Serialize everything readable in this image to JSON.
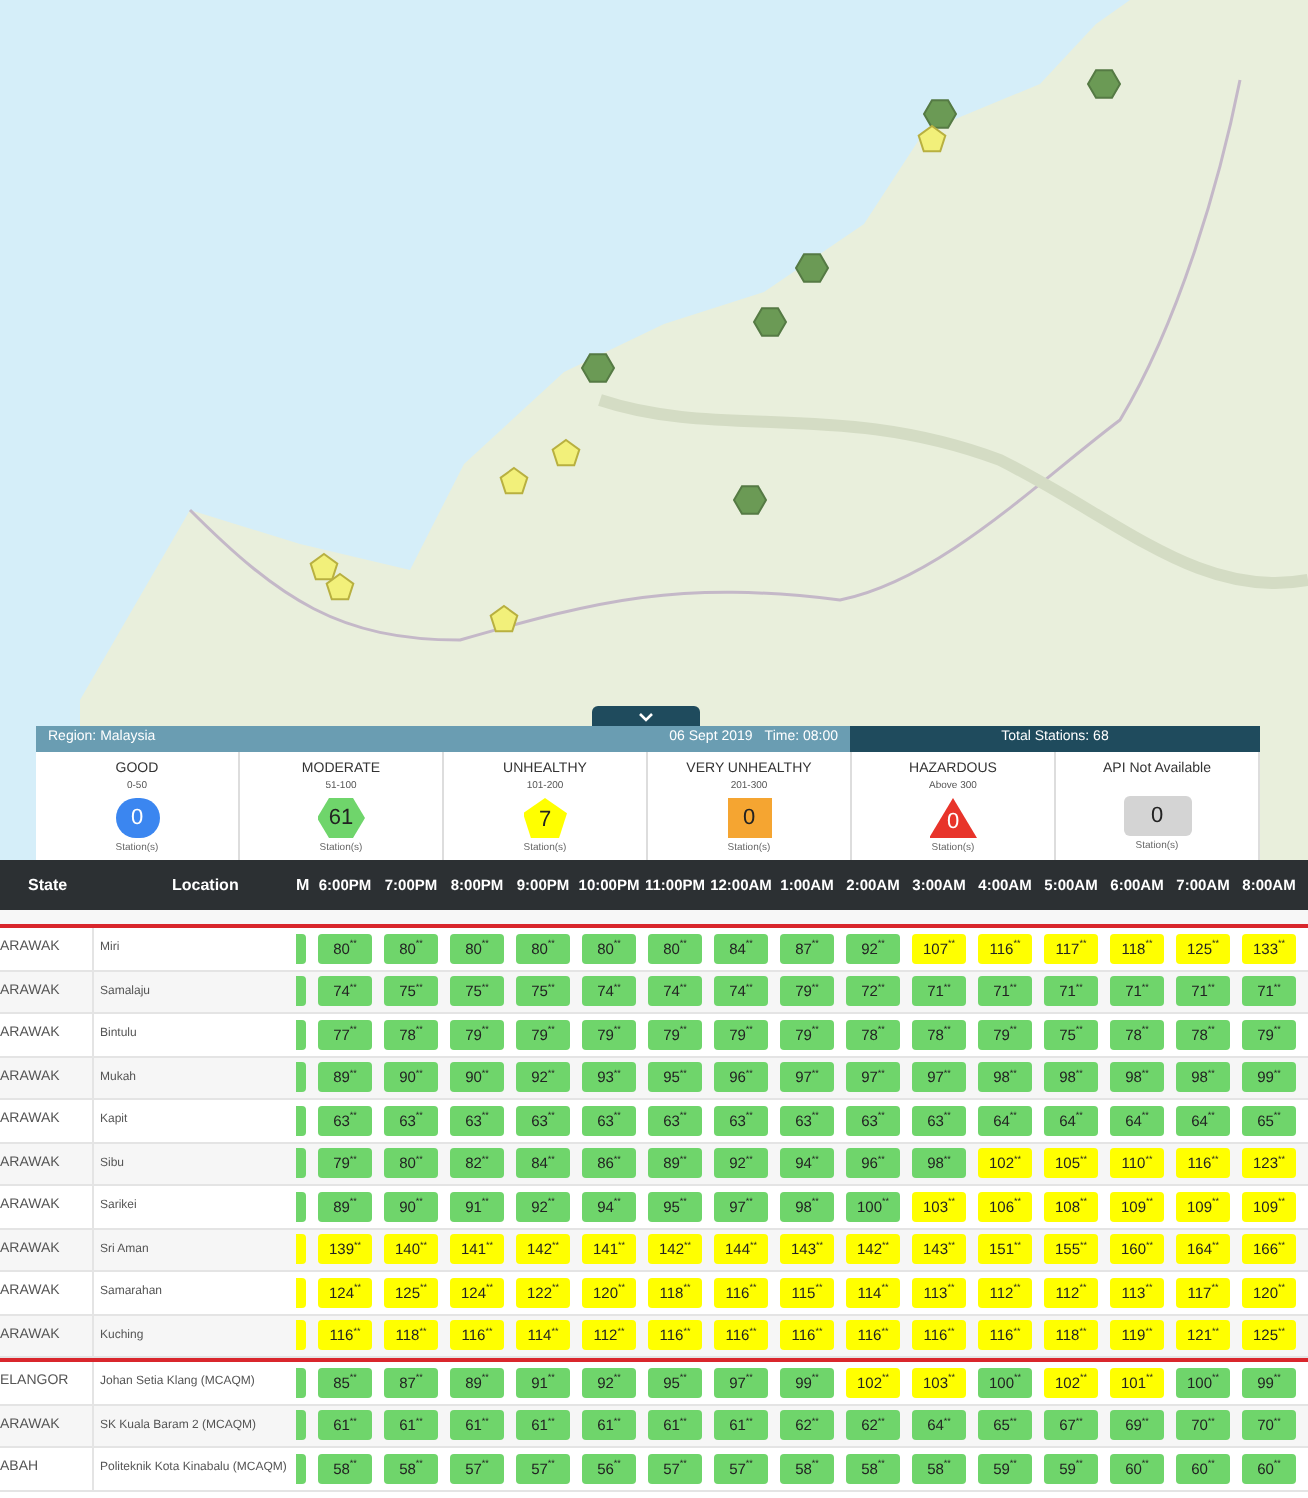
{
  "panel": {
    "region": "Region: Malaysia",
    "date": "06 Sept 2019",
    "time": "Time: 08:00",
    "total": "Total Stations: 68"
  },
  "categories": [
    {
      "name": "GOOD",
      "range": "0-50",
      "count": "0",
      "kind": "circle",
      "color": "#3b86f0",
      "caption": "Station(s)"
    },
    {
      "name": "MODERATE",
      "range": "51-100",
      "count": "61",
      "kind": "hexagon",
      "color": "#6fd56b",
      "caption": "Station(s)"
    },
    {
      "name": "UNHEALTHY",
      "range": "101-200",
      "count": "7",
      "kind": "pentagon",
      "color": "#ffff00",
      "caption": "Station(s)"
    },
    {
      "name": "VERY UNHEALTHY",
      "range": "201-300",
      "count": "0",
      "kind": "square",
      "color": "#f5a531",
      "caption": "Station(s)"
    },
    {
      "name": "HAZARDOUS",
      "range": "Above 300",
      "count": "0",
      "kind": "triangle",
      "color": "#e8342a",
      "caption": "Station(s)"
    },
    {
      "name": "API Not Available",
      "count": "0",
      "kind": "rounded",
      "color": "#d4d4d4",
      "caption": "Station(s)"
    }
  ],
  "table": {
    "columns": [
      "State",
      "Location",
      "M",
      "6:00PM",
      "7:00PM",
      "8:00PM",
      "9:00PM",
      "10:00PM",
      "11:00PM",
      "12:00AM",
      "1:00AM",
      "2:00AM",
      "3:00AM",
      "4:00AM",
      "5:00AM",
      "6:00AM",
      "7:00AM",
      "8:00AM"
    ],
    "groups": [
      {
        "rows": [
          {
            "state": "ARAWAK",
            "location": "Miri",
            "cut_cell": {
              "color": "#6fd56b"
            },
            "cells": [
              {
                "value": "80",
                "flag": "**",
                "color": "#6fd56b"
              },
              {
                "value": "80",
                "flag": "**",
                "color": "#6fd56b"
              },
              {
                "value": "80",
                "flag": "**",
                "color": "#6fd56b"
              },
              {
                "value": "80",
                "flag": "**",
                "color": "#6fd56b"
              },
              {
                "value": "80",
                "flag": "**",
                "color": "#6fd56b"
              },
              {
                "value": "80",
                "flag": "**",
                "color": "#6fd56b"
              },
              {
                "value": "84",
                "flag": "**",
                "color": "#6fd56b"
              },
              {
                "value": "87",
                "flag": "**",
                "color": "#6fd56b"
              },
              {
                "value": "92",
                "flag": "**",
                "color": "#6fd56b"
              },
              {
                "value": "107",
                "flag": "**",
                "color": "#ffff00"
              },
              {
                "value": "116",
                "flag": "**",
                "color": "#ffff00"
              },
              {
                "value": "117",
                "flag": "**",
                "color": "#ffff00"
              },
              {
                "value": "118",
                "flag": "**",
                "color": "#ffff00"
              },
              {
                "value": "125",
                "flag": "**",
                "color": "#ffff00"
              },
              {
                "value": "133",
                "flag": "**",
                "color": "#ffff00"
              }
            ]
          },
          {
            "state": "ARAWAK",
            "location": "Samalaju",
            "cut_cell": {
              "color": "#6fd56b"
            },
            "cells": [
              {
                "value": "74",
                "flag": "**",
                "color": "#6fd56b"
              },
              {
                "value": "75",
                "flag": "**",
                "color": "#6fd56b"
              },
              {
                "value": "75",
                "flag": "**",
                "color": "#6fd56b"
              },
              {
                "value": "75",
                "flag": "**",
                "color": "#6fd56b"
              },
              {
                "value": "74",
                "flag": "**",
                "color": "#6fd56b"
              },
              {
                "value": "74",
                "flag": "**",
                "color": "#6fd56b"
              },
              {
                "value": "74",
                "flag": "**",
                "color": "#6fd56b"
              },
              {
                "value": "79",
                "flag": "**",
                "color": "#6fd56b"
              },
              {
                "value": "72",
                "flag": "**",
                "color": "#6fd56b"
              },
              {
                "value": "71",
                "flag": "**",
                "color": "#6fd56b"
              },
              {
                "value": "71",
                "flag": "**",
                "color": "#6fd56b"
              },
              {
                "value": "71",
                "flag": "**",
                "color": "#6fd56b"
              },
              {
                "value": "71",
                "flag": "**",
                "color": "#6fd56b"
              },
              {
                "value": "71",
                "flag": "**",
                "color": "#6fd56b"
              },
              {
                "value": "71",
                "flag": "**",
                "color": "#6fd56b"
              }
            ]
          },
          {
            "state": "ARAWAK",
            "location": "Bintulu",
            "cut_cell": {
              "color": "#6fd56b"
            },
            "cells": [
              {
                "value": "77",
                "flag": "**",
                "color": "#6fd56b"
              },
              {
                "value": "78",
                "flag": "**",
                "color": "#6fd56b"
              },
              {
                "value": "79",
                "flag": "**",
                "color": "#6fd56b"
              },
              {
                "value": "79",
                "flag": "**",
                "color": "#6fd56b"
              },
              {
                "value": "79",
                "flag": "**",
                "color": "#6fd56b"
              },
              {
                "value": "79",
                "flag": "**",
                "color": "#6fd56b"
              },
              {
                "value": "79",
                "flag": "**",
                "color": "#6fd56b"
              },
              {
                "value": "79",
                "flag": "**",
                "color": "#6fd56b"
              },
              {
                "value": "78",
                "flag": "**",
                "color": "#6fd56b"
              },
              {
                "value": "78",
                "flag": "**",
                "color": "#6fd56b"
              },
              {
                "value": "79",
                "flag": "**",
                "color": "#6fd56b"
              },
              {
                "value": "75",
                "flag": "**",
                "color": "#6fd56b"
              },
              {
                "value": "78",
                "flag": "**",
                "color": "#6fd56b"
              },
              {
                "value": "78",
                "flag": "**",
                "color": "#6fd56b"
              },
              {
                "value": "79",
                "flag": "**",
                "color": "#6fd56b"
              }
            ]
          },
          {
            "state": "ARAWAK",
            "location": "Mukah",
            "cut_cell": {
              "color": "#6fd56b"
            },
            "cells": [
              {
                "value": "89",
                "flag": "**",
                "color": "#6fd56b"
              },
              {
                "value": "90",
                "flag": "**",
                "color": "#6fd56b"
              },
              {
                "value": "90",
                "flag": "**",
                "color": "#6fd56b"
              },
              {
                "value": "92",
                "flag": "**",
                "color": "#6fd56b"
              },
              {
                "value": "93",
                "flag": "**",
                "color": "#6fd56b"
              },
              {
                "value": "95",
                "flag": "**",
                "color": "#6fd56b"
              },
              {
                "value": "96",
                "flag": "**",
                "color": "#6fd56b"
              },
              {
                "value": "97",
                "flag": "**",
                "color": "#6fd56b"
              },
              {
                "value": "97",
                "flag": "**",
                "color": "#6fd56b"
              },
              {
                "value": "97",
                "flag": "**",
                "color": "#6fd56b"
              },
              {
                "value": "98",
                "flag": "**",
                "color": "#6fd56b"
              },
              {
                "value": "98",
                "flag": "**",
                "color": "#6fd56b"
              },
              {
                "value": "98",
                "flag": "**",
                "color": "#6fd56b"
              },
              {
                "value": "98",
                "flag": "**",
                "color": "#6fd56b"
              },
              {
                "value": "99",
                "flag": "**",
                "color": "#6fd56b"
              }
            ]
          },
          {
            "state": "ARAWAK",
            "location": "Kapit",
            "cut_cell": {
              "color": "#6fd56b"
            },
            "cells": [
              {
                "value": "63",
                "flag": "**",
                "color": "#6fd56b"
              },
              {
                "value": "63",
                "flag": "**",
                "color": "#6fd56b"
              },
              {
                "value": "63",
                "flag": "**",
                "color": "#6fd56b"
              },
              {
                "value": "63",
                "flag": "**",
                "color": "#6fd56b"
              },
              {
                "value": "63",
                "flag": "**",
                "color": "#6fd56b"
              },
              {
                "value": "63",
                "flag": "**",
                "color": "#6fd56b"
              },
              {
                "value": "63",
                "flag": "**",
                "color": "#6fd56b"
              },
              {
                "value": "63",
                "flag": "**",
                "color": "#6fd56b"
              },
              {
                "value": "63",
                "flag": "**",
                "color": "#6fd56b"
              },
              {
                "value": "63",
                "flag": "**",
                "color": "#6fd56b"
              },
              {
                "value": "64",
                "flag": "**",
                "color": "#6fd56b"
              },
              {
                "value": "64",
                "flag": "**",
                "color": "#6fd56b"
              },
              {
                "value": "64",
                "flag": "**",
                "color": "#6fd56b"
              },
              {
                "value": "64",
                "flag": "**",
                "color": "#6fd56b"
              },
              {
                "value": "65",
                "flag": "**",
                "color": "#6fd56b"
              }
            ]
          },
          {
            "state": "ARAWAK",
            "location": "Sibu",
            "cut_cell": {
              "color": "#6fd56b"
            },
            "cells": [
              {
                "value": "79",
                "flag": "**",
                "color": "#6fd56b"
              },
              {
                "value": "80",
                "flag": "**",
                "color": "#6fd56b"
              },
              {
                "value": "82",
                "flag": "**",
                "color": "#6fd56b"
              },
              {
                "value": "84",
                "flag": "**",
                "color": "#6fd56b"
              },
              {
                "value": "86",
                "flag": "**",
                "color": "#6fd56b"
              },
              {
                "value": "89",
                "flag": "**",
                "color": "#6fd56b"
              },
              {
                "value": "92",
                "flag": "**",
                "color": "#6fd56b"
              },
              {
                "value": "94",
                "flag": "**",
                "color": "#6fd56b"
              },
              {
                "value": "96",
                "flag": "**",
                "color": "#6fd56b"
              },
              {
                "value": "98",
                "flag": "**",
                "color": "#6fd56b"
              },
              {
                "value": "102",
                "flag": "**",
                "color": "#ffff00"
              },
              {
                "value": "105",
                "flag": "**",
                "color": "#ffff00"
              },
              {
                "value": "110",
                "flag": "**",
                "color": "#ffff00"
              },
              {
                "value": "116",
                "flag": "**",
                "color": "#ffff00"
              },
              {
                "value": "123",
                "flag": "**",
                "color": "#ffff00"
              }
            ]
          },
          {
            "state": "ARAWAK",
            "location": "Sarikei",
            "cut_cell": {
              "color": "#6fd56b"
            },
            "cells": [
              {
                "value": "89",
                "flag": "**",
                "color": "#6fd56b"
              },
              {
                "value": "90",
                "flag": "**",
                "color": "#6fd56b"
              },
              {
                "value": "91",
                "flag": "**",
                "color": "#6fd56b"
              },
              {
                "value": "92",
                "flag": "**",
                "color": "#6fd56b"
              },
              {
                "value": "94",
                "flag": "**",
                "color": "#6fd56b"
              },
              {
                "value": "95",
                "flag": "**",
                "color": "#6fd56b"
              },
              {
                "value": "97",
                "flag": "**",
                "color": "#6fd56b"
              },
              {
                "value": "98",
                "flag": "**",
                "color": "#6fd56b"
              },
              {
                "value": "100",
                "flag": "**",
                "color": "#6fd56b"
              },
              {
                "value": "103",
                "flag": "**",
                "color": "#ffff00"
              },
              {
                "value": "106",
                "flag": "**",
                "color": "#ffff00"
              },
              {
                "value": "108",
                "flag": "**",
                "color": "#ffff00"
              },
              {
                "value": "109",
                "flag": "**",
                "color": "#ffff00"
              },
              {
                "value": "109",
                "flag": "**",
                "color": "#ffff00"
              },
              {
                "value": "109",
                "flag": "**",
                "color": "#ffff00"
              }
            ]
          },
          {
            "state": "ARAWAK",
            "location": "Sri Aman",
            "cut_cell": {
              "color": "#ffff00"
            },
            "cells": [
              {
                "value": "139",
                "flag": "**",
                "color": "#ffff00"
              },
              {
                "value": "140",
                "flag": "**",
                "color": "#ffff00"
              },
              {
                "value": "141",
                "flag": "**",
                "color": "#ffff00"
              },
              {
                "value": "142",
                "flag": "**",
                "color": "#ffff00"
              },
              {
                "value": "141",
                "flag": "**",
                "color": "#ffff00"
              },
              {
                "value": "142",
                "flag": "**",
                "color": "#ffff00"
              },
              {
                "value": "144",
                "flag": "**",
                "color": "#ffff00"
              },
              {
                "value": "143",
                "flag": "**",
                "color": "#ffff00"
              },
              {
                "value": "142",
                "flag": "**",
                "color": "#ffff00"
              },
              {
                "value": "143",
                "flag": "**",
                "color": "#ffff00"
              },
              {
                "value": "151",
                "flag": "**",
                "color": "#ffff00"
              },
              {
                "value": "155",
                "flag": "**",
                "color": "#ffff00"
              },
              {
                "value": "160",
                "flag": "**",
                "color": "#ffff00"
              },
              {
                "value": "164",
                "flag": "**",
                "color": "#ffff00"
              },
              {
                "value": "166",
                "flag": "**",
                "color": "#ffff00"
              }
            ]
          },
          {
            "state": "ARAWAK",
            "location": "Samarahan",
            "cut_cell": {
              "color": "#ffff00"
            },
            "cells": [
              {
                "value": "124",
                "flag": "**",
                "color": "#ffff00"
              },
              {
                "value": "125",
                "flag": "**",
                "color": "#ffff00"
              },
              {
                "value": "124",
                "flag": "**",
                "color": "#ffff00"
              },
              {
                "value": "122",
                "flag": "**",
                "color": "#ffff00"
              },
              {
                "value": "120",
                "flag": "**",
                "color": "#ffff00"
              },
              {
                "value": "118",
                "flag": "**",
                "color": "#ffff00"
              },
              {
                "value": "116",
                "flag": "**",
                "color": "#ffff00"
              },
              {
                "value": "115",
                "flag": "**",
                "color": "#ffff00"
              },
              {
                "value": "114",
                "flag": "**",
                "color": "#ffff00"
              },
              {
                "value": "113",
                "flag": "**",
                "color": "#ffff00"
              },
              {
                "value": "112",
                "flag": "**",
                "color": "#ffff00"
              },
              {
                "value": "112",
                "flag": "**",
                "color": "#ffff00"
              },
              {
                "value": "113",
                "flag": "**",
                "color": "#ffff00"
              },
              {
                "value": "117",
                "flag": "**",
                "color": "#ffff00"
              },
              {
                "value": "120",
                "flag": "**",
                "color": "#ffff00"
              }
            ]
          },
          {
            "state": "ARAWAK",
            "location": "Kuching",
            "cut_cell": {
              "color": "#ffff00"
            },
            "cells": [
              {
                "value": "116",
                "flag": "**",
                "color": "#ffff00"
              },
              {
                "value": "118",
                "flag": "**",
                "color": "#ffff00"
              },
              {
                "value": "116",
                "flag": "**",
                "color": "#ffff00"
              },
              {
                "value": "114",
                "flag": "**",
                "color": "#ffff00"
              },
              {
                "value": "112",
                "flag": "**",
                "color": "#ffff00"
              },
              {
                "value": "116",
                "flag": "**",
                "color": "#ffff00"
              },
              {
                "value": "116",
                "flag": "**",
                "color": "#ffff00"
              },
              {
                "value": "116",
                "flag": "**",
                "color": "#ffff00"
              },
              {
                "value": "116",
                "flag": "**",
                "color": "#ffff00"
              },
              {
                "value": "116",
                "flag": "**",
                "color": "#ffff00"
              },
              {
                "value": "116",
                "flag": "**",
                "color": "#ffff00"
              },
              {
                "value": "118",
                "flag": "**",
                "color": "#ffff00"
              },
              {
                "value": "119",
                "flag": "**",
                "color": "#ffff00"
              },
              {
                "value": "121",
                "flag": "**",
                "color": "#ffff00"
              },
              {
                "value": "125",
                "flag": "**",
                "color": "#ffff00"
              }
            ]
          }
        ]
      },
      {
        "rows": [
          {
            "state": "ELANGOR",
            "location": "Johan Setia Klang (MCAQM)",
            "cut_cell": {
              "color": "#6fd56b"
            },
            "cells": [
              {
                "value": "85",
                "flag": "**",
                "color": "#6fd56b"
              },
              {
                "value": "87",
                "flag": "**",
                "color": "#6fd56b"
              },
              {
                "value": "89",
                "flag": "**",
                "color": "#6fd56b"
              },
              {
                "value": "91",
                "flag": "**",
                "color": "#6fd56b"
              },
              {
                "value": "92",
                "flag": "**",
                "color": "#6fd56b"
              },
              {
                "value": "95",
                "flag": "**",
                "color": "#6fd56b"
              },
              {
                "value": "97",
                "flag": "**",
                "color": "#6fd56b"
              },
              {
                "value": "99",
                "flag": "**",
                "color": "#6fd56b"
              },
              {
                "value": "102",
                "flag": "**",
                "color": "#ffff00"
              },
              {
                "value": "103",
                "flag": "**",
                "color": "#ffff00"
              },
              {
                "value": "100",
                "flag": "**",
                "color": "#6fd56b"
              },
              {
                "value": "102",
                "flag": "**",
                "color": "#ffff00"
              },
              {
                "value": "101",
                "flag": "**",
                "color": "#ffff00"
              },
              {
                "value": "100",
                "flag": "**",
                "color": "#6fd56b"
              },
              {
                "value": "99",
                "flag": "**",
                "color": "#6fd56b"
              }
            ]
          },
          {
            "state": "ARAWAK",
            "location": "SK Kuala Baram 2 (MCAQM)",
            "cut_cell": {
              "color": "#6fd56b"
            },
            "cells": [
              {
                "value": "61",
                "flag": "**",
                "color": "#6fd56b"
              },
              {
                "value": "61",
                "flag": "**",
                "color": "#6fd56b"
              },
              {
                "value": "61",
                "flag": "**",
                "color": "#6fd56b"
              },
              {
                "value": "61",
                "flag": "**",
                "color": "#6fd56b"
              },
              {
                "value": "61",
                "flag": "**",
                "color": "#6fd56b"
              },
              {
                "value": "61",
                "flag": "**",
                "color": "#6fd56b"
              },
              {
                "value": "61",
                "flag": "**",
                "color": "#6fd56b"
              },
              {
                "value": "62",
                "flag": "**",
                "color": "#6fd56b"
              },
              {
                "value": "62",
                "flag": "**",
                "color": "#6fd56b"
              },
              {
                "value": "64",
                "flag": "**",
                "color": "#6fd56b"
              },
              {
                "value": "65",
                "flag": "**",
                "color": "#6fd56b"
              },
              {
                "value": "67",
                "flag": "**",
                "color": "#6fd56b"
              },
              {
                "value": "69",
                "flag": "**",
                "color": "#6fd56b"
              },
              {
                "value": "70",
                "flag": "**",
                "color": "#6fd56b"
              },
              {
                "value": "70",
                "flag": "**",
                "color": "#6fd56b"
              }
            ]
          },
          {
            "state": "ABAH",
            "location": "Politeknik Kota Kinabalu (MCAQM)",
            "cut_cell": {
              "color": "#6fd56b"
            },
            "cells": [
              {
                "value": "58",
                "flag": "**",
                "color": "#6fd56b"
              },
              {
                "value": "58",
                "flag": "**",
                "color": "#6fd56b"
              },
              {
                "value": "57",
                "flag": "**",
                "color": "#6fd56b"
              },
              {
                "value": "57",
                "flag": "**",
                "color": "#6fd56b"
              },
              {
                "value": "56",
                "flag": "**",
                "color": "#6fd56b"
              },
              {
                "value": "57",
                "flag": "**",
                "color": "#6fd56b"
              },
              {
                "value": "57",
                "flag": "**",
                "color": "#6fd56b"
              },
              {
                "value": "58",
                "flag": "**",
                "color": "#6fd56b"
              },
              {
                "value": "58",
                "flag": "**",
                "color": "#6fd56b"
              },
              {
                "value": "58",
                "flag": "**",
                "color": "#6fd56b"
              },
              {
                "value": "59",
                "flag": "**",
                "color": "#6fd56b"
              },
              {
                "value": "59",
                "flag": "**",
                "color": "#6fd56b"
              },
              {
                "value": "60",
                "flag": "**",
                "color": "#6fd56b"
              },
              {
                "value": "60",
                "flag": "**",
                "color": "#6fd56b"
              },
              {
                "value": "60",
                "flag": "**",
                "color": "#6fd56b"
              }
            ]
          }
        ]
      }
    ]
  }
}
